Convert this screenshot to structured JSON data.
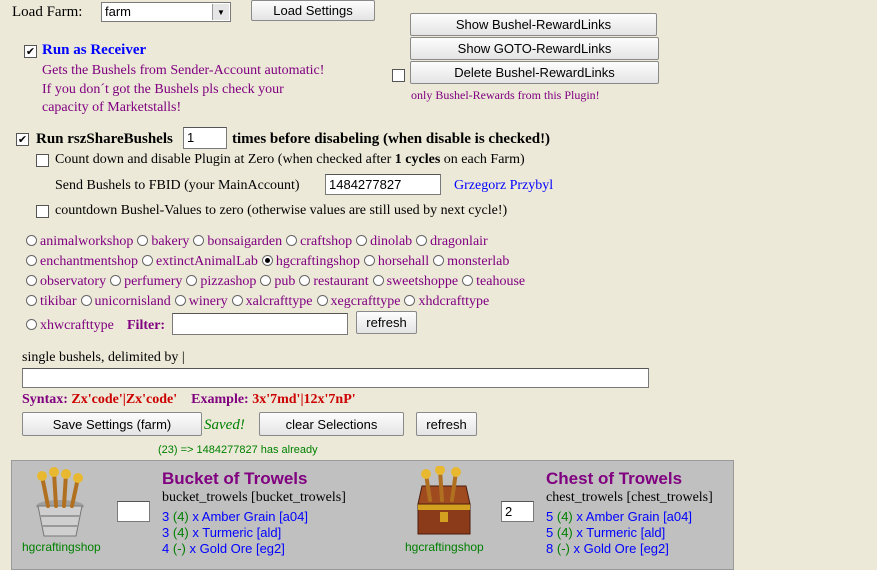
{
  "load_farm": {
    "label": "Load Farm:",
    "selected": "farm",
    "button": "Load Settings"
  },
  "reward_links": {
    "show_bushel": "Show Bushel-RewardLinks",
    "show_goto": "Show GOTO-RewardLinks",
    "delete_bushel": "Delete Bushel-RewardLinks",
    "note": "only Bushel-Rewards from this Plugin!"
  },
  "receiver": {
    "label": "Run as Receiver",
    "desc1": "Gets the Bushels from Sender-Account automatic!",
    "desc2": "If you don´t got the Bushels pls check your",
    "desc3": "capacity of Marketstalls!"
  },
  "share": {
    "label": "Run rszShareBushels",
    "times": "1",
    "suffix": "times before disabeling (when disable is checked!)",
    "countdown_pre": "Count down and disable Plugin at Zero (when checked after",
    "countdown_num": "1 cycles",
    "countdown_post": "on each Farm)",
    "send_label": "Send Bushels to FBID (your MainAccount)",
    "fbid": "1484277827",
    "user_name": "Grzegorz Przybyl",
    "countdown_values": "countdown Bushel-Values to zero (otherwise values are still used by next cycle!)"
  },
  "shops": [
    [
      "animalworkshop",
      "bakery",
      "bonsaigarden",
      "craftshop",
      "dinolab",
      "dragonlair"
    ],
    [
      "enchantmentshop",
      "extinctAnimalLab",
      "hgcraftingshop",
      "horsehall",
      "monsterlab"
    ],
    [
      "observatory",
      "perfumery",
      "pizzashop",
      "pub",
      "restaurant",
      "sweetshoppe",
      "teahouse"
    ],
    [
      "tikibar",
      "unicornisland",
      "winery",
      "xalcrafttype",
      "xegcrafttype",
      "xhdcrafttype"
    ],
    [
      "xhwcrafttype"
    ]
  ],
  "selected_shop": "hgcraftingshop",
  "filter": {
    "label": "Filter:",
    "value": "",
    "button": "refresh"
  },
  "single": {
    "label": "single bushels, delimited by |",
    "value": "",
    "syntax_label": "Syntax:",
    "syntax_value": "Zx'code'|Zx'code'",
    "example_label": "Example:",
    "example_value": "3x'7md'|12x'7nP'"
  },
  "actions": {
    "save": "Save Settings (farm)",
    "saved": "Saved!",
    "clear": "clear Selections",
    "refresh": "refresh",
    "status": "(23) => 1484277827 has already"
  },
  "items": [
    {
      "shop": "hgcraftingshop",
      "title": "Bucket of Trowels",
      "code": "bucket_trowels [bucket_trowels]",
      "qty": "",
      "rewards": [
        {
          "n": "3",
          "paren": "(4)",
          "text": "x Amber Grain [a04]"
        },
        {
          "n": "3",
          "paren": "(4)",
          "text": "x Turmeric [ald]"
        },
        {
          "n": "4",
          "paren": "(-)",
          "text": "x Gold Ore [eg2]"
        }
      ]
    },
    {
      "shop": "hgcraftingshop",
      "title": "Chest of Trowels",
      "code": "chest_trowels [chest_trowels]",
      "qty": "2",
      "rewards": [
        {
          "n": "5",
          "paren": "(4)",
          "text": "x Amber Grain [a04]"
        },
        {
          "n": "5",
          "paren": "(4)",
          "text": "x Turmeric [ald]"
        },
        {
          "n": "8",
          "paren": "(-)",
          "text": "x Gold Ore [eg2]"
        }
      ]
    }
  ],
  "colors": {
    "background": "#ece9d8",
    "purple": "#800080",
    "blue": "#0000ff",
    "red": "#cc0000",
    "green": "#008000",
    "panel": "#c0c0c0"
  }
}
